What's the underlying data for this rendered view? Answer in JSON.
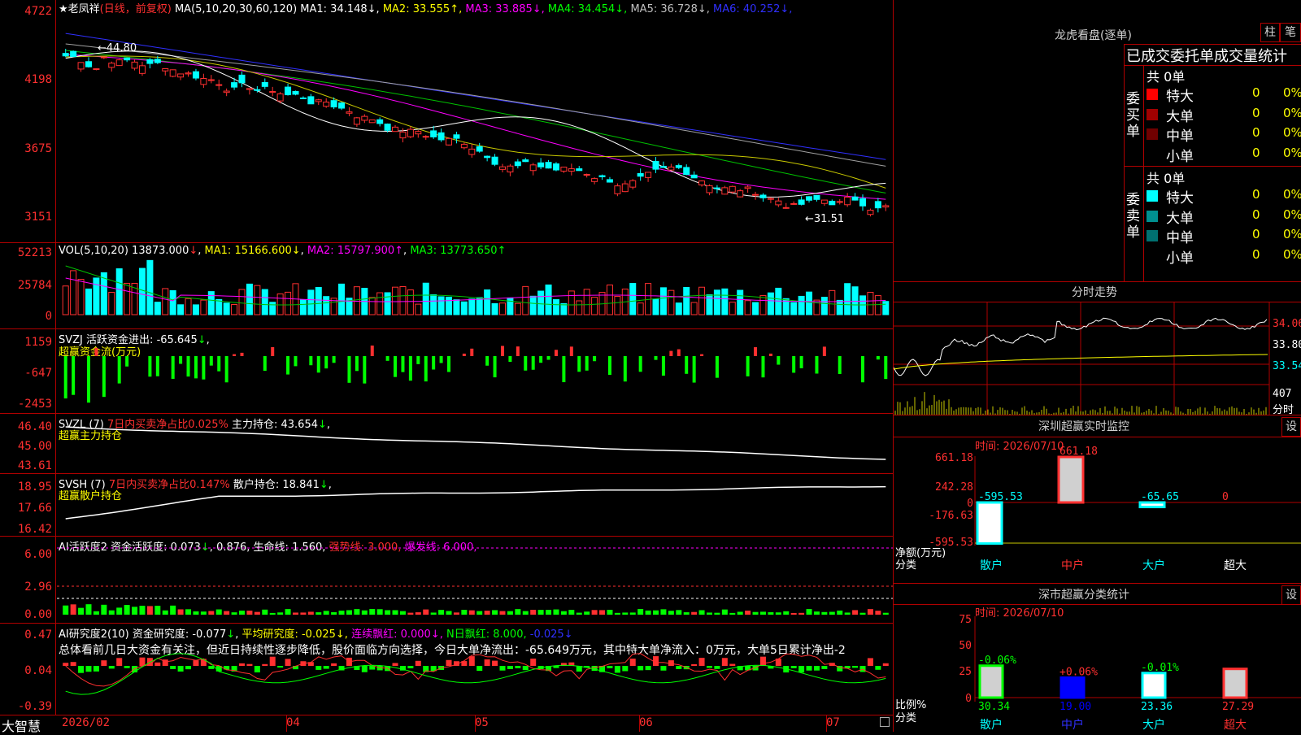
{
  "stock": {
    "name": "老凤祥",
    "star": "★",
    "period": "(日线，前复权)"
  },
  "main_header": {
    "ma_label": "MA(5,10,20,30,60,120)",
    "items": [
      {
        "label": "MA1:",
        "value": "34.148",
        "arrow": "↓",
        "color": "#ffffff"
      },
      {
        "label": "MA2:",
        "value": "33.555",
        "arrow": "↑",
        "color": "#ffff00"
      },
      {
        "label": "MA3:",
        "value": "33.885",
        "arrow": "↓",
        "color": "#ff00ff"
      },
      {
        "label": "MA4:",
        "value": "34.454",
        "arrow": "↓",
        "color": "#00ff00"
      },
      {
        "label": "MA5:",
        "value": "36.728",
        "arrow": "↓",
        "color": "#c0c0c0"
      },
      {
        "label": "MA6:",
        "value": "40.252",
        "arrow": "↓",
        "color": "#3030ff"
      }
    ],
    "y_ticks": [
      "4722",
      "4198",
      "3675",
      "3151"
    ],
    "high_label": "44.80",
    "low_label": "31.51"
  },
  "vol_panel": {
    "header": "VOL(5,10,20)",
    "vol": "13873.000",
    "ma1": "15166.600",
    "ma2": "15797.900",
    "ma3": "13773.650",
    "y_ticks": [
      "52213",
      "25784",
      "0"
    ]
  },
  "svzj": {
    "header": "SVZJ",
    "label": "活跃资金进出:",
    "value": "-65.645",
    "subtitle": "超赢资金流(万元)",
    "y_ticks": [
      "1159",
      "-647",
      "-2453"
    ]
  },
  "svzl": {
    "header": "SVZL (7)",
    "label1": "7日内买卖净占比0.025%",
    "label2": "主力持仓:",
    "value": "43.654",
    "subtitle": "超赢主力持仓",
    "y_ticks": [
      "46.40",
      "45.00",
      "43.61"
    ]
  },
  "svsh": {
    "header": "SVSH (7)",
    "label1": "7日内买卖净占比0.147%",
    "label2": "散户持仓:",
    "value": "18.841",
    "subtitle": "超赢散户持仓",
    "y_ticks": [
      "18.95",
      "17.66",
      "16.42"
    ]
  },
  "ai_active": {
    "header": "AI活跃度2",
    "label": "资金活跃度:",
    "v1": "0.073",
    "v2": "0.876",
    "life_label": "生命线:",
    "life": "1.560",
    "strong_label": "强势线:",
    "strong": "3.000",
    "burst_label": "爆发线:",
    "burst": "6.000",
    "y_ticks": [
      "6.00",
      "2.96",
      "0.00"
    ]
  },
  "ai_research": {
    "header": "AI研究度2(10)",
    "r_label": "资金研究度:",
    "r_val": "-0.077",
    "avg_label": "平均研究度:",
    "avg_val": "-0.025",
    "cont_label": "连续飘红:",
    "cont_val": "0.000",
    "n_label": "N日飘红:",
    "n_val": "8.000",
    "last_val": "-0.025",
    "comment": "总体看前几日大资金有关注，但近日持续性逐步降低，股价面临方向选择，今日大单净流出：-65.649万元，其中特大单净流入：0万元，大单5日累计净出-2",
    "y_ticks": [
      "0.47",
      "0.04",
      "-0.39"
    ]
  },
  "xaxis": {
    "brand": "大智慧",
    "labels": [
      "2026/02",
      "04",
      "05",
      "06",
      "07"
    ]
  },
  "right": {
    "dragon_title": "龙虎看盘(逐单)",
    "btn_zhu": "柱",
    "btn_bi": "笔",
    "deal_title": "已成交委托单成交量统计",
    "buy_side": "委买单",
    "sell_side": "委卖单",
    "buy_total": "共 0单",
    "sell_total": "共 0单",
    "buy_rows": [
      {
        "label": "特大",
        "count": "0",
        "pct": "0%",
        "color": "#ff0000"
      },
      {
        "label": "大单",
        "count": "0",
        "pct": "0%",
        "color": "#a00000"
      },
      {
        "label": "中单",
        "count": "0",
        "pct": "0%",
        "color": "#700000"
      },
      {
        "label": "小单",
        "count": "0",
        "pct": "0%",
        "color": ""
      }
    ],
    "sell_rows": [
      {
        "label": "特大",
        "count": "0",
        "pct": "0%",
        "color": "#00ffff"
      },
      {
        "label": "大单",
        "count": "0",
        "pct": "0%",
        "color": "#009090"
      },
      {
        "label": "中单",
        "count": "0",
        "pct": "0%",
        "color": "#007070"
      },
      {
        "label": "小单",
        "count": "0",
        "pct": "0%",
        "color": ""
      }
    ],
    "intraday_title": "分时走势",
    "intraday_ticks": [
      "34.06",
      "33.80",
      "33.54"
    ],
    "intraday_vol": "407",
    "intraday_vol_label": "分时",
    "monitor_title": "深圳超赢实时监控",
    "monitor_btn": "设",
    "monitor_time": "时间: 2026/07/10",
    "monitor_y": [
      "661.18",
      "242.28",
      "0",
      "-176.63",
      "-595.53"
    ],
    "monitor_axis_label": "净额(万元)",
    "monitor_cat_label": "分类",
    "monitor_bars": [
      {
        "cat": "散户",
        "value": "-595.53"
      },
      {
        "cat": "中户",
        "value": "661.18"
      },
      {
        "cat": "大户",
        "value": "-65.65"
      },
      {
        "cat": "超大",
        "value": "0"
      }
    ],
    "stats_title": "深市超赢分类统计",
    "stats_btn": "设",
    "stats_time": "时间: 2026/07/10",
    "stats_y": [
      "75",
      "50",
      "25",
      "0"
    ],
    "stats_axis_label": "比例%",
    "stats_cat_label": "分类",
    "stats_bars": [
      {
        "cat": "散户",
        "pct": "-0.06%",
        "value": "30.34"
      },
      {
        "cat": "中户",
        "pct": "+0.06%",
        "value": "19.00"
      },
      {
        "cat": "大户",
        "pct": "-0.01%",
        "value": "23.36"
      },
      {
        "cat": "超大",
        "pct": "",
        "value": "27.29"
      }
    ]
  }
}
